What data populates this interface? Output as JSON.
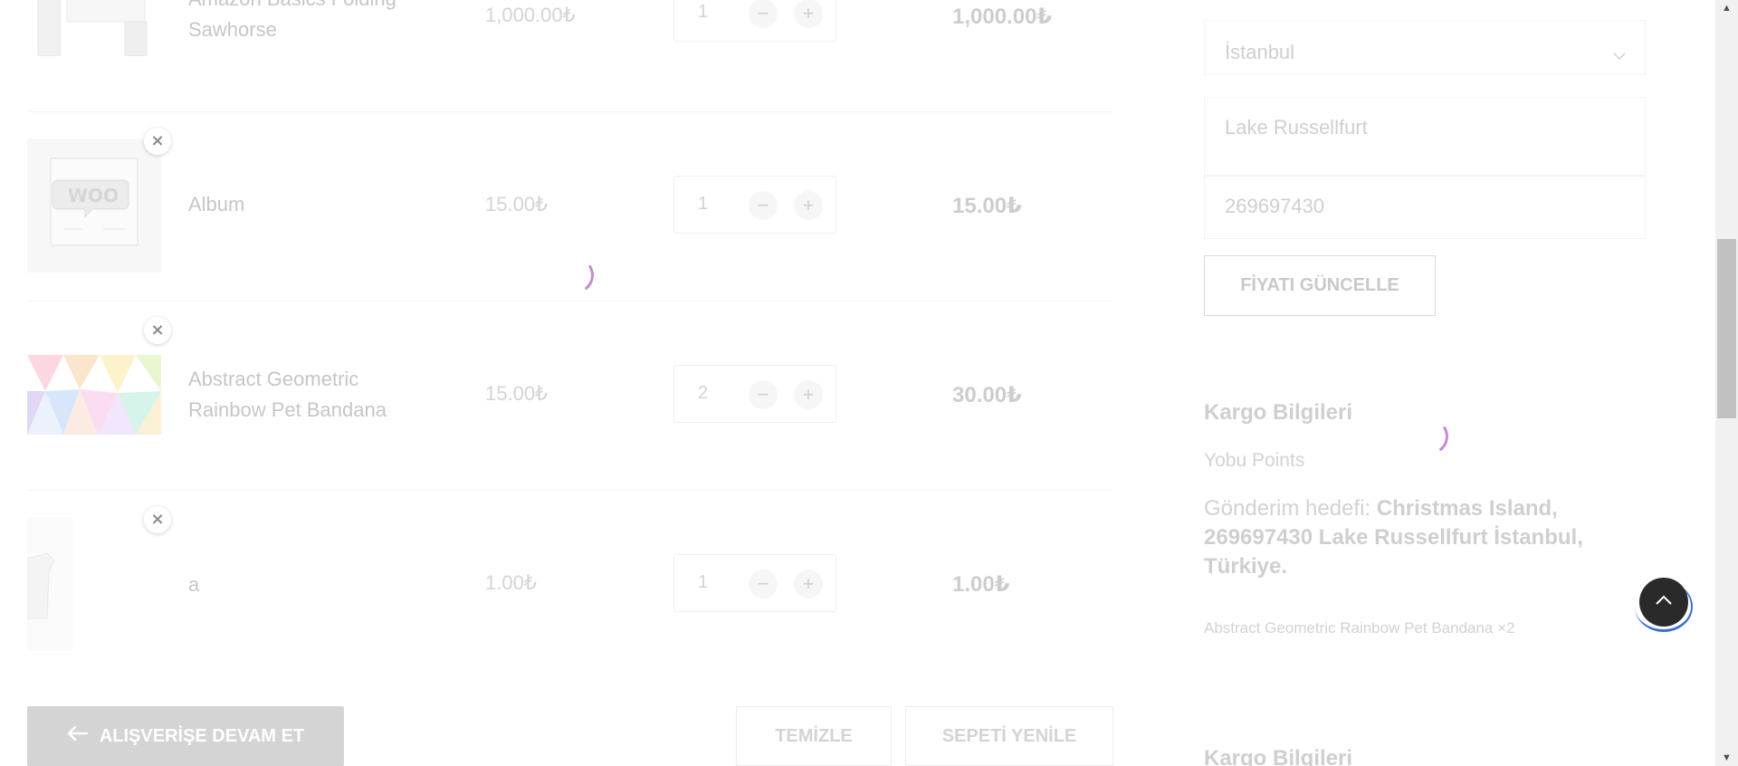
{
  "cart": {
    "items": [
      {
        "name": "Amazon Basics Folding Sawhorse",
        "price": "1,000.00₺",
        "qty": "1",
        "subtotal": "1,000.00₺",
        "image": "sawhorse-image"
      },
      {
        "name": "Album",
        "price": "15.00₺",
        "qty": "1",
        "subtotal": "15.00₺",
        "image": "woo-album-image",
        "image_text": "WOO"
      },
      {
        "name": "Abstract Geometric Rainbow Pet Bandana",
        "price": "15.00₺",
        "qty": "2",
        "subtotal": "30.00₺",
        "image": "rainbow-bandana-image"
      },
      {
        "name": "a",
        "price": "1.00₺",
        "qty": "1",
        "subtotal": "1.00₺",
        "image": "tshirt-image"
      }
    ],
    "remove_symbol": "×",
    "minus_symbol": "−",
    "plus_symbol": "+",
    "continue_label": "ALIŞVERİŞE DEVAM ET",
    "clear_label": "TEMİZLE",
    "update_cart_label": "SEPETİ YENİLE"
  },
  "shipping_calc": {
    "city_select": "İstanbul",
    "town_value": "Lake Russellfurt",
    "postcode_value": "269697430",
    "update_price_label": "FİYATI GÜNCELLE"
  },
  "shipping_info": {
    "title": "Kargo Bilgileri",
    "method": "Yobu Points",
    "destination_label": "Gönderim hedefi:",
    "destination_value": "Christmas Island, 269697430 Lake Russellfurt İstanbul, Türkiye.",
    "items": "Abstract Geometric Rainbow Pet Bandana ×2",
    "title_2": "Kargo Bilgileri"
  },
  "colors": {
    "spinner": "#c78ad6",
    "to_top_bg": "#2a2a2a",
    "to_top_ring": "#3b6fd8",
    "continue_bg": "#d4d4d4"
  },
  "icons": {
    "arrow_left": "arrow-left-icon",
    "chevron_down": "chevron-down-icon",
    "chevron_up": "chevron-up-icon"
  }
}
